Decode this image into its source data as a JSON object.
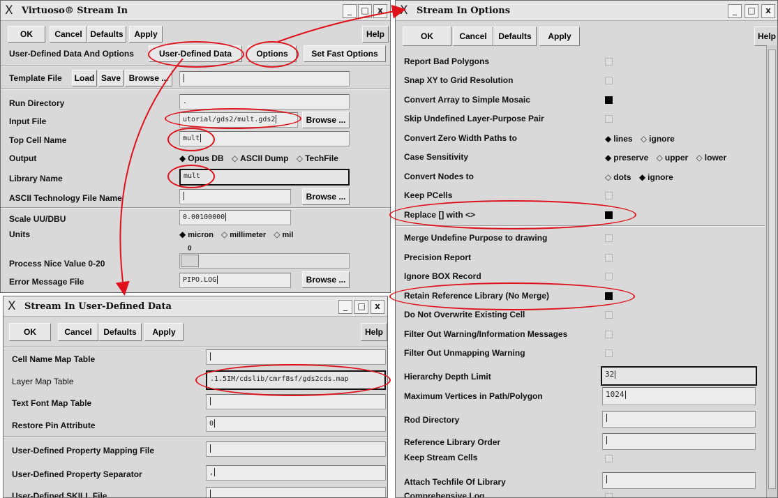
{
  "stream_in": {
    "title": "Virtuoso® Stream In",
    "buttons": {
      "ok": "OK",
      "cancel": "Cancel",
      "defaults": "Defaults",
      "apply": "Apply",
      "help": "Help"
    },
    "option_row": {
      "label": "User-Defined Data And Options",
      "user_defined_data": "User-Defined Data",
      "options": "Options",
      "set_fast_options": "Set Fast Options"
    },
    "template": {
      "label": "Template File",
      "load": "Load",
      "save": "Save",
      "browse": "Browse ...",
      "value": ""
    },
    "run_directory": {
      "label": "Run Directory",
      "value": "."
    },
    "input_file": {
      "label": "Input File",
      "value": "utorial/gds2/mult.gds2",
      "browse": "Browse ..."
    },
    "top_cell": {
      "label": "Top Cell Name",
      "value": "mult"
    },
    "output": {
      "label": "Output",
      "options": [
        "Opus DB",
        "ASCII Dump",
        "TechFile"
      ],
      "selected": "Opus DB"
    },
    "library_name": {
      "label": "Library Name",
      "value": "mult"
    },
    "ascii_tech": {
      "label": "ASCII Technology File Name",
      "value": "",
      "browse": "Browse ..."
    },
    "scale": {
      "label": "Scale UU/DBU",
      "value": "0.00100000"
    },
    "units": {
      "label": "Units",
      "options": [
        "micron",
        "millimeter",
        "mil"
      ],
      "selected": "micron"
    },
    "nice_value": {
      "label": "Process Nice Value 0-20",
      "value": "0"
    },
    "error_file": {
      "label": "Error Message File",
      "value": "PIPO.LOG",
      "browse": "Browse ..."
    }
  },
  "user_defined": {
    "title": "Stream In User-Defined Data",
    "buttons": {
      "ok": "OK",
      "cancel": "Cancel",
      "defaults": "Defaults",
      "apply": "Apply",
      "help": "Help"
    },
    "rows": [
      {
        "label": "Cell Name Map Table",
        "value": ""
      },
      {
        "label": "Layer Map Table",
        "value": ".1.5IM/cdslib/cmrf8sf/gds2cds.map"
      },
      {
        "label": "Text Font Map Table",
        "value": ""
      },
      {
        "label": "Restore Pin Attribute",
        "value": "0"
      },
      {
        "label": "User-Defined Property Mapping File",
        "value": ""
      },
      {
        "label": "User-Defined Property Separator",
        "value": ","
      },
      {
        "label": "User-Defined SKILL File",
        "value": ""
      }
    ]
  },
  "options": {
    "title": "Stream In Options",
    "buttons": {
      "ok": "OK",
      "cancel": "Cancel",
      "defaults": "Defaults",
      "apply": "Apply",
      "help": "Help"
    },
    "checks": [
      {
        "label": "Report Bad Polygons",
        "checked": false
      },
      {
        "label": "Snap XY to Grid Resolution",
        "checked": false
      },
      {
        "label": "Convert Array to Simple Mosaic",
        "checked": true
      },
      {
        "label": "Skip Undefined Layer-Purpose Pair",
        "checked": false
      }
    ],
    "zero_width": {
      "label": "Convert Zero Width Paths to",
      "options": [
        "lines",
        "ignore"
      ],
      "selected": "lines"
    },
    "case_sensitivity": {
      "label": "Case Sensitivity",
      "options": [
        "preserve",
        "upper",
        "lower"
      ],
      "selected": "preserve"
    },
    "convert_nodes": {
      "label": "Convert Nodes to",
      "options": [
        "dots",
        "ignore"
      ],
      "selected": "ignore"
    },
    "keep_pcells": {
      "label": "Keep PCells",
      "checked": false
    },
    "replace_brackets": {
      "label": "Replace [] with <>",
      "checked": true
    },
    "checks2": [
      {
        "label": "Merge Undefine Purpose to drawing",
        "checked": false
      },
      {
        "label": "Precision Report",
        "checked": false
      },
      {
        "label": "Ignore BOX Record",
        "checked": false
      },
      {
        "label": "Retain Reference Library (No Merge)",
        "checked": true
      },
      {
        "label": "Do Not Overwrite Existing Cell",
        "checked": false
      },
      {
        "label": "Filter Out Warning/Information Messages",
        "checked": false
      },
      {
        "label": "Filter Out Unmapping Warning",
        "checked": false
      }
    ],
    "hierarchy_depth": {
      "label": "Hierarchy Depth Limit",
      "value": "32"
    },
    "max_vertices": {
      "label": "Maximum Vertices in Path/Polygon",
      "value": "1024"
    },
    "rod_directory": {
      "label": "Rod Directory",
      "value": ""
    },
    "ref_lib_order": {
      "label": "Reference Library Order",
      "value": ""
    },
    "keep_stream_cells": {
      "label": "Keep Stream Cells",
      "checked": false
    },
    "attach_techfile": {
      "label": "Attach Techfile Of Library",
      "value": ""
    },
    "comprehensive_log": {
      "label": "Comprehensive Log",
      "checked": false
    }
  },
  "window_controls": {
    "minimize": "_",
    "maximize": "□",
    "close": "x",
    "x_logo": "X"
  },
  "colors": {
    "annotation": "#e0101a",
    "window_bg": "#d9d9d9"
  }
}
